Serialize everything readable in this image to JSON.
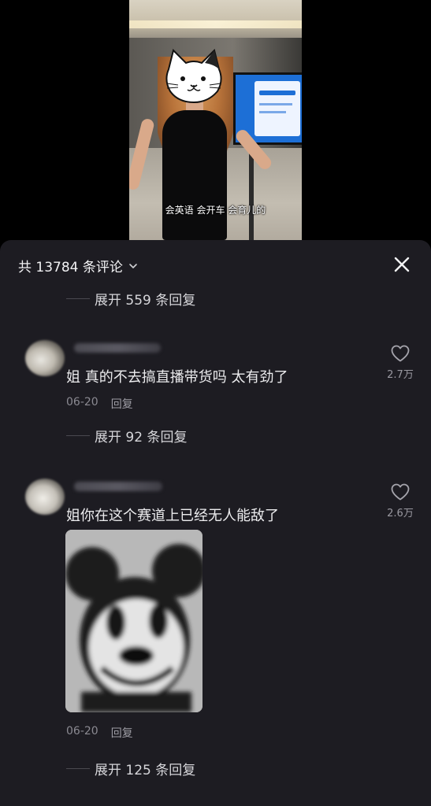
{
  "video": {
    "caption": "会英语 会开车 会育儿的"
  },
  "header": {
    "count_label": "共 13784 条评论",
    "close_icon": "close-icon",
    "chevron_icon": "chevron-down-icon"
  },
  "threads": [
    {
      "expand_label": "展开 559 条回复"
    },
    {
      "text": "姐 真的不去搞直播带货吗 太有劲了",
      "date": "06-20",
      "reply_label": "回复",
      "likes": "2.7万",
      "expand_label": "展开 92 条回复"
    },
    {
      "text": "姐你在这个赛道上已经无人能敌了",
      "date": "06-20",
      "reply_label": "回复",
      "likes": "2.6万",
      "expand_label": "展开 125 条回复"
    }
  ],
  "colors": {
    "sheet_bg": "#1d1c22",
    "text_primary": "#ececee",
    "text_secondary": "#8b8a92"
  }
}
